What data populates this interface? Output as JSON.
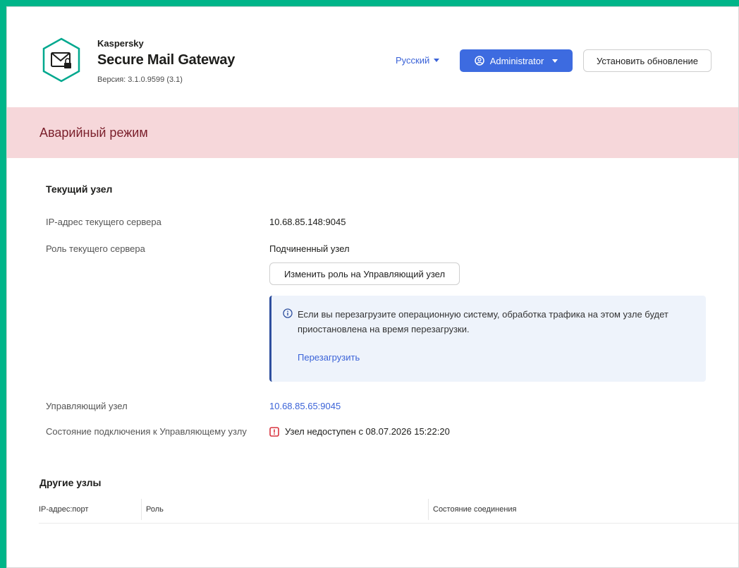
{
  "header": {
    "vendor": "Kaspersky",
    "product": "Secure Mail Gateway",
    "version": "Версия: 3.1.0.9599 (3.1)",
    "language": "Русский",
    "user": "Administrator",
    "update_button": "Установить обновление"
  },
  "banner": {
    "title": "Аварийный режим"
  },
  "current_node": {
    "section_title": "Текущий узел",
    "ip_label": "IP-адрес текущего сервера",
    "ip_value": "10.68.85.148:9045",
    "role_label": "Роль текущего сервера",
    "role_value": "Подчиненный узел",
    "change_role_button": "Изменить роль на Управляющий узел",
    "info_text": "Если вы перезагрузите операционную систему, обработка трафика на этом узле будет приостановлена на время перезагрузки.",
    "reboot_link": "Перезагрузить",
    "manager_label": "Управляющий узел",
    "manager_value": "10.68.85.65:9045",
    "connection_label": "Состояние подключения к Управляющему узлу",
    "connection_value": "Узел недоступен с 08.07.2026 15:22:20"
  },
  "other_nodes": {
    "section_title": "Другие узлы",
    "columns": [
      "IP-адрес:порт",
      "Роль",
      "Состояние соединения"
    ]
  },
  "colors": {
    "accent": "#3d6be0",
    "banner_bg": "#f6d7da",
    "banner_text": "#7a1f2b",
    "error": "#d9343f",
    "frame": "#00b589"
  },
  "icons": {
    "logo": "mail-lock-hexagon-icon",
    "user": "user-circle-icon",
    "info": "info-circle-icon",
    "error": "error-square-icon"
  }
}
